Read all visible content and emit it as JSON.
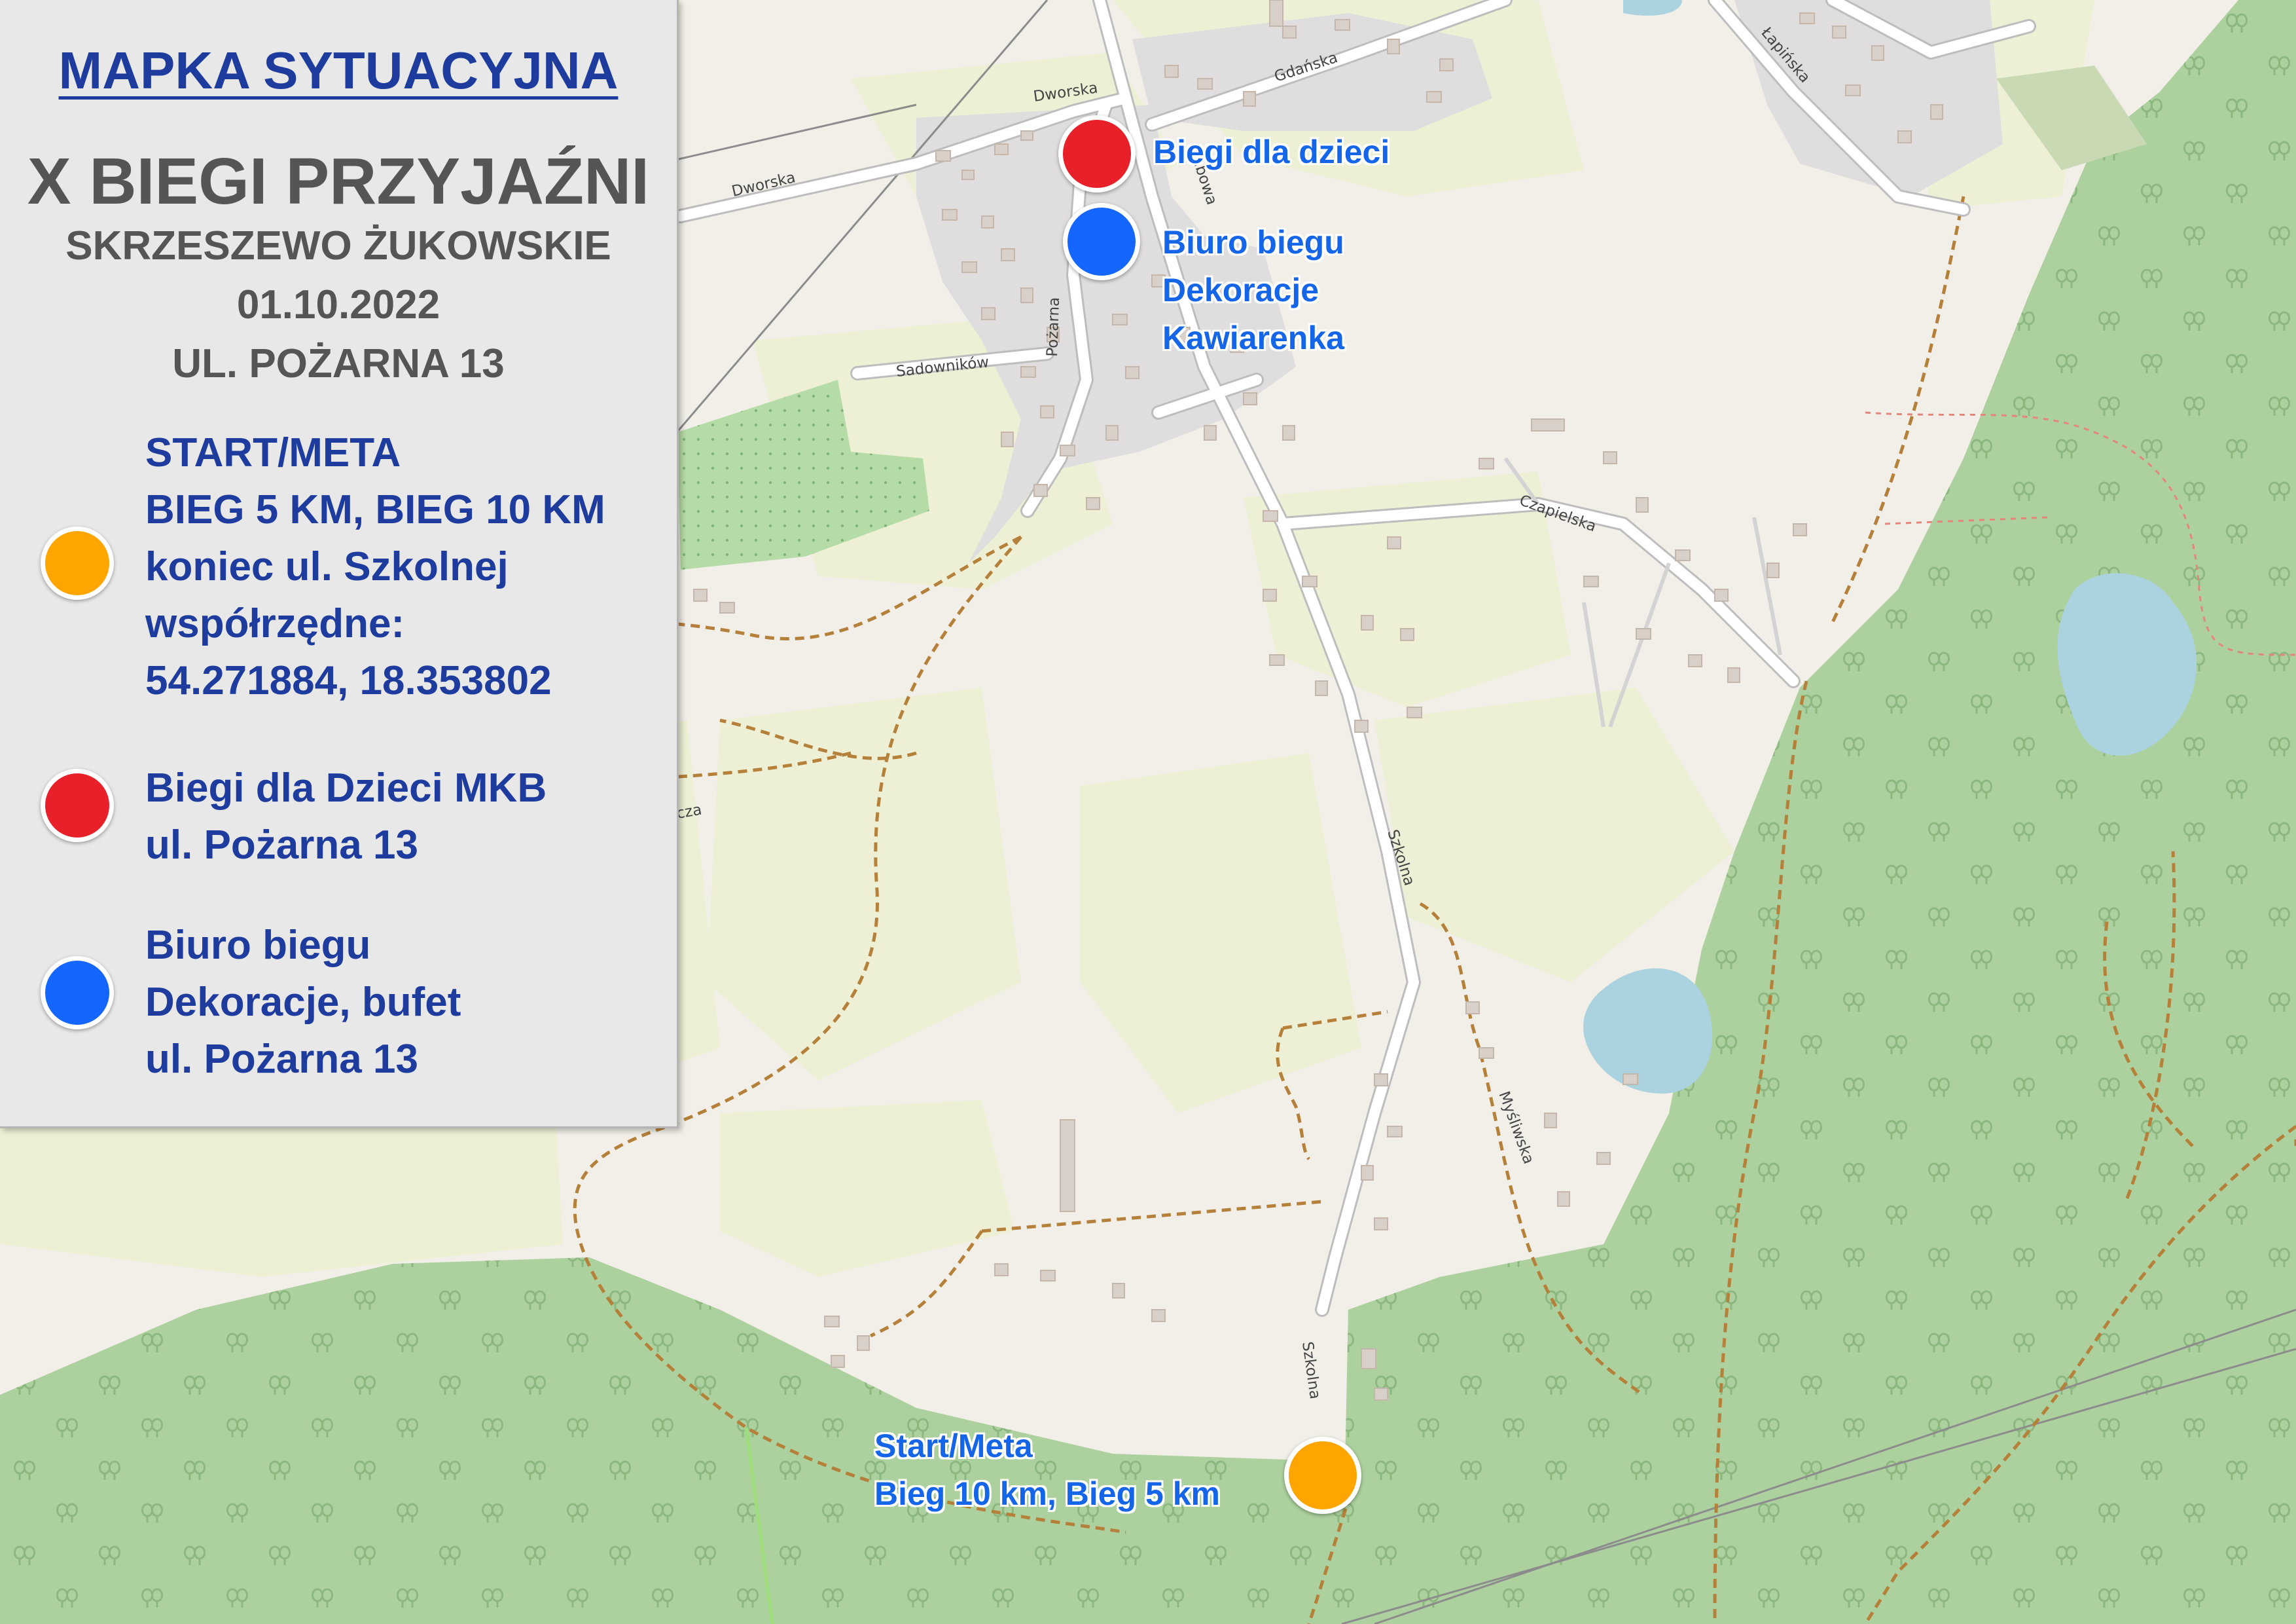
{
  "legend": {
    "title": "MAPKA SYTUACYJNA",
    "event_name": "X BIEGI PRZYJAŹNI",
    "location": "SKRZESZEWO ŻUKOWSKIE",
    "date": "01.10.2022",
    "address": "UL. POŻARNA 13",
    "items": [
      {
        "color": "#ffa500",
        "lines": [
          "START/META",
          "BIEG 5 KM, BIEG 10 KM",
          "koniec ul. Szkolnej",
          "współrzędne:",
          "54.271884, 18.353802"
        ]
      },
      {
        "color": "#e8202a",
        "lines": [
          "Biegi dla Dzieci MKB",
          "ul. Pożarna 13"
        ]
      },
      {
        "color": "#1565ff",
        "lines": [
          "Biuro biegu",
          "Dekoracje, bufet",
          "ul. Pożarna 13"
        ]
      }
    ]
  },
  "markers": [
    {
      "type": "red",
      "color": "#e8202a",
      "label_lines": [
        "Biegi dla dzieci"
      ]
    },
    {
      "type": "blue",
      "color": "#1565ff",
      "label_lines": [
        "Biuro biegu",
        "Dekoracje",
        "Kawiarenka"
      ]
    },
    {
      "type": "orange",
      "color": "#ffa500",
      "label_lines": [
        "Start/Meta",
        "Bieg 10 km, Bieg 5 km"
      ]
    }
  ],
  "street_labels": {
    "dworska_west": "Dworska",
    "dworska_north": "Dworska",
    "gdanska": "Gdańska",
    "lapinska": "Łapińska",
    "sadownikow": "Sadowników",
    "pozarna": "Pożarna",
    "lubowa": "Lubowa",
    "czapielska": "Czapielska",
    "szkolna_north": "Szkolna",
    "szkolna_south": "Szkolna",
    "mysliwska": "Myśliwska",
    "cza": "cza"
  },
  "map_colors": {
    "land": "#f2efe9",
    "forest": "#add19e",
    "meadow": "#eef0d5",
    "residential": "#e0dfdf",
    "water": "#aad3df",
    "road": "#ffffff",
    "path": "#b5803a"
  }
}
